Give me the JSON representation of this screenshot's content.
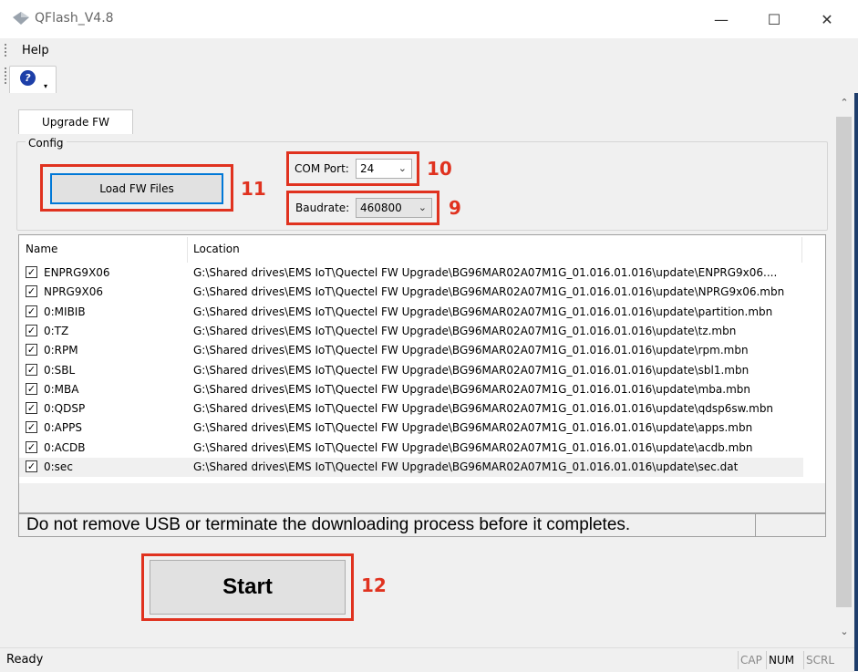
{
  "window": {
    "title": "QFlash_V4.8",
    "minimize": "—",
    "maximize": "☐",
    "close": "✕"
  },
  "menu": {
    "help": "Help"
  },
  "toolbar": {
    "help_icon": "?",
    "dropdown_arrow": "▾"
  },
  "tab": {
    "label": "Upgrade FW"
  },
  "config": {
    "group_label": "Config",
    "load_fw_label": "Load FW Files",
    "com_port_label": "COM Port:",
    "com_port_value": "24",
    "baudrate_label": "Baudrate:",
    "baudrate_value": "460800"
  },
  "annotations": {
    "n11": "11",
    "n10": "10",
    "n9": "9",
    "n12": "12",
    "color": "#e0321f"
  },
  "file_list": {
    "columns": [
      "Name",
      "Location"
    ],
    "rows": [
      {
        "name": "ENPRG9X06",
        "location": "G:\\Shared drives\\EMS IoT\\Quectel FW Upgrade\\BG96MAR02A07M1G_01.016.01.016\\update\\ENPRG9x06....",
        "checked": true
      },
      {
        "name": "NPRG9X06",
        "location": "G:\\Shared drives\\EMS IoT\\Quectel FW Upgrade\\BG96MAR02A07M1G_01.016.01.016\\update\\NPRG9x06.mbn",
        "checked": true
      },
      {
        "name": "0:MIBIB",
        "location": "G:\\Shared drives\\EMS IoT\\Quectel FW Upgrade\\BG96MAR02A07M1G_01.016.01.016\\update\\partition.mbn",
        "checked": true
      },
      {
        "name": "0:TZ",
        "location": "G:\\Shared drives\\EMS IoT\\Quectel FW Upgrade\\BG96MAR02A07M1G_01.016.01.016\\update\\tz.mbn",
        "checked": true
      },
      {
        "name": "0:RPM",
        "location": "G:\\Shared drives\\EMS IoT\\Quectel FW Upgrade\\BG96MAR02A07M1G_01.016.01.016\\update\\rpm.mbn",
        "checked": true
      },
      {
        "name": "0:SBL",
        "location": "G:\\Shared drives\\EMS IoT\\Quectel FW Upgrade\\BG96MAR02A07M1G_01.016.01.016\\update\\sbl1.mbn",
        "checked": true
      },
      {
        "name": "0:MBA",
        "location": "G:\\Shared drives\\EMS IoT\\Quectel FW Upgrade\\BG96MAR02A07M1G_01.016.01.016\\update\\mba.mbn",
        "checked": true
      },
      {
        "name": "0:QDSP",
        "location": "G:\\Shared drives\\EMS IoT\\Quectel FW Upgrade\\BG96MAR02A07M1G_01.016.01.016\\update\\qdsp6sw.mbn",
        "checked": true
      },
      {
        "name": "0:APPS",
        "location": "G:\\Shared drives\\EMS IoT\\Quectel FW Upgrade\\BG96MAR02A07M1G_01.016.01.016\\update\\apps.mbn",
        "checked": true
      },
      {
        "name": "0:ACDB",
        "location": "G:\\Shared drives\\EMS IoT\\Quectel FW Upgrade\\BG96MAR02A07M1G_01.016.01.016\\update\\acdb.mbn",
        "checked": true
      },
      {
        "name": "0:sec",
        "location": "G:\\Shared drives\\EMS IoT\\Quectel FW Upgrade\\BG96MAR02A07M1G_01.016.01.016\\update\\sec.dat",
        "checked": true,
        "selected": true
      }
    ]
  },
  "message": "Do not remove USB or terminate the downloading process before it completes.",
  "start_label": "Start",
  "statusbar": {
    "text": "Ready",
    "cap": "CAP",
    "num": "NUM",
    "scrl": "SCRL"
  },
  "scrollbar": {
    "up": "⌃",
    "down": "⌄"
  },
  "chevron": "⌄"
}
